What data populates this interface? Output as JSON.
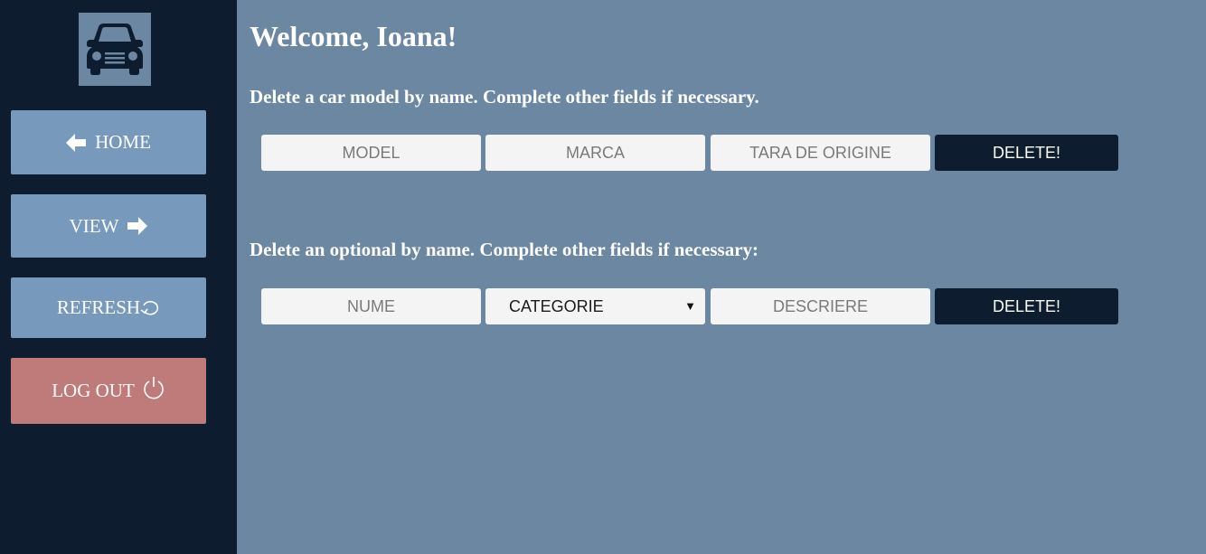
{
  "sidebar": {
    "logo_icon": "car-icon",
    "home_label": "HOME",
    "view_label": "VIEW",
    "refresh_label": "REFRESH",
    "logout_label": "LOG OUT"
  },
  "main": {
    "welcome": "Welcome, Ioana!",
    "section_model": {
      "title": "Delete a car model by name. Complete other fields if necessary.",
      "model_placeholder": "MODEL",
      "marca_placeholder": "MARCA",
      "tara_placeholder": "TARA DE ORIGINE",
      "delete_label": "DELETE!"
    },
    "section_optional": {
      "title": "Delete an optional by name. Complete other fields if necessary:",
      "nume_placeholder": "NUME",
      "categorie_selected": "CATEGORIE",
      "descriere_placeholder": "DESCRIERE",
      "delete_label": "DELETE!"
    }
  },
  "colors": {
    "sidebar_bg": "#0d1c2e",
    "main_bg": "#6b87a2",
    "nav_button": "#7799bc",
    "logout_button": "#bf7a7a",
    "delete_button": "#0d1c2e"
  }
}
